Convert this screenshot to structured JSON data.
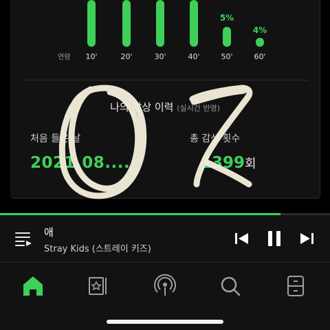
{
  "colors": {
    "accent": "#3fd05a",
    "background": "#000000",
    "card": "#121212"
  },
  "age_chart": {
    "axis_label": "연령",
    "groups": [
      {
        "label": "10'",
        "pct_text": "",
        "level": 1.0
      },
      {
        "label": "20'",
        "pct_text": "",
        "level": 1.0
      },
      {
        "label": "30'",
        "pct_text": "",
        "level": 1.0
      },
      {
        "label": "40'",
        "pct_text": "",
        "level": 1.0
      },
      {
        "label": "50'",
        "pct_text": "5%",
        "level": 0.05
      },
      {
        "label": "60'",
        "pct_text": "4%",
        "level": 0.04
      }
    ]
  },
  "history": {
    "title": "나의 감상 이력",
    "subtitle": "(실시간 반영)",
    "first_listen_label": "처음 들은 날",
    "first_listen_value": "2021.08....",
    "total_plays_label": "총 감상 횟수",
    "total_plays_value": "1399",
    "total_plays_unit": "회"
  },
  "handwriting": "07",
  "player": {
    "progress": 0.85,
    "track_title": "애",
    "artist": "Stray Kids (스트레이 키즈)",
    "queue_icon": "queue-list-icon",
    "prev_icon": "skip-previous-icon",
    "pause_icon": "pause-icon",
    "next_icon": "skip-next-icon"
  },
  "nav": {
    "items": [
      {
        "name": "home-icon",
        "active": true
      },
      {
        "name": "browse-icon",
        "active": false
      },
      {
        "name": "podcast-icon",
        "active": false
      },
      {
        "name": "search-icon",
        "active": false
      },
      {
        "name": "library-icon",
        "active": false
      }
    ]
  }
}
